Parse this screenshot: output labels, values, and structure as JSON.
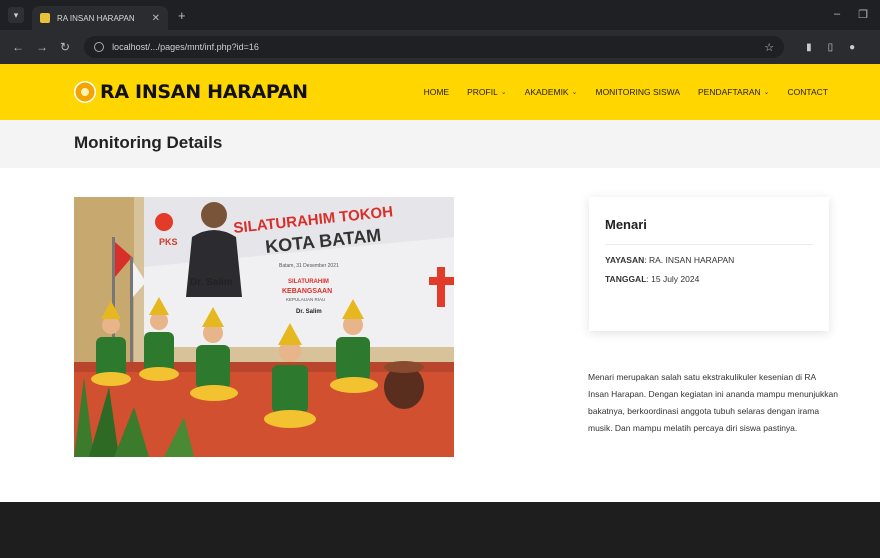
{
  "browser": {
    "tab_title": "RA INSAN HARAPAN",
    "url": "localhost/.../pages/mnt/inf.php?id=16"
  },
  "site": {
    "logo_text": "RA INSAN HARAPAN",
    "nav": [
      {
        "label": "HOME",
        "dropdown": false
      },
      {
        "label": "PROFIL",
        "dropdown": true
      },
      {
        "label": "AKADEMIK",
        "dropdown": true
      },
      {
        "label": "MONITORING SISWA",
        "dropdown": false
      },
      {
        "label": "PENDAFTARAN",
        "dropdown": true
      },
      {
        "label": "CONTACT",
        "dropdown": false
      }
    ]
  },
  "page": {
    "title": "Monitoring Details"
  },
  "photo": {
    "banner_line1": "SILATURAHIM TOKOH",
    "banner_line2": "KOTA BATAM",
    "banner_date": "Batam, 31 Desember 2021",
    "party": "PKS",
    "person": "Dr. Salim",
    "sub1": "SILATURAHIM",
    "sub2": "KEBANGSAAN",
    "sub3": "KEPULAUAN RIAU",
    "sub_person": "Dr. Salim"
  },
  "detail": {
    "title": "Menari",
    "yayasan_key": "YAYASAN",
    "yayasan_val": ": RA. INSAN HARAPAN",
    "tanggal_key": "TANGGAL",
    "tanggal_val": ": 15 July 2024",
    "description": "Menari merupakan salah satu ekstrakulikuler kesenian di RA Insan Harapan. Dengan kegiatan ini ananda mampu menunjukkan bakatnya, berkoordinasi anggota tubuh selaras dengan irama musik. Dan mampu melatih percaya diri siswa pastinya."
  }
}
